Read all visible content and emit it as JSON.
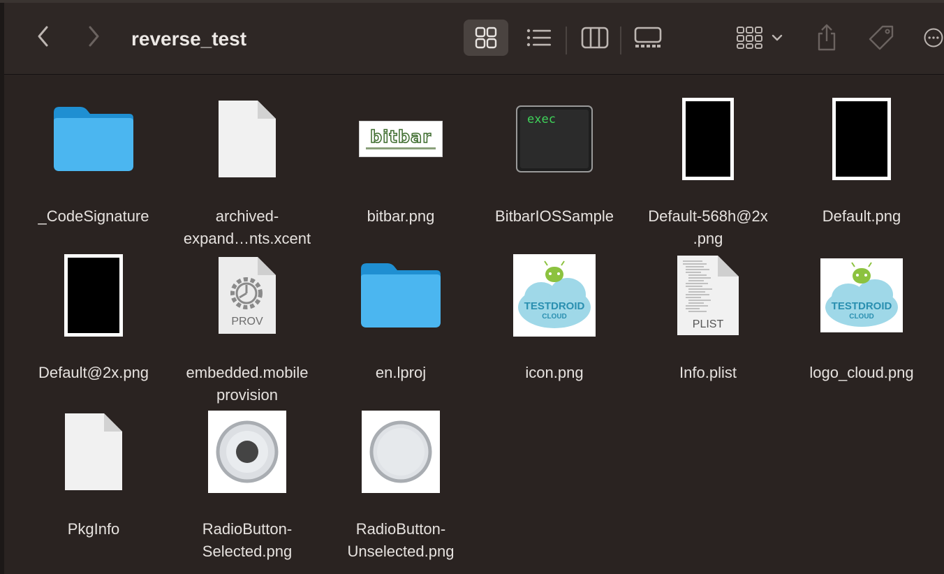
{
  "window": {
    "title": "reverse_test"
  },
  "toolbar": {
    "back_icon": "chevron-left-icon",
    "forward_icon": "chevron-right-icon",
    "view_modes": [
      "icon-grid-icon",
      "list-view-icon",
      "column-view-icon",
      "gallery-view-icon"
    ],
    "active_view": "icon-grid-icon",
    "group_icon": "group-by-icon",
    "share_icon": "share-icon",
    "tag_icon": "tag-icon",
    "more_icon": "more-icon"
  },
  "files": [
    {
      "name": "_CodeSignature",
      "kind": "folder"
    },
    {
      "name": "archived-\nexpand…nts.xcent",
      "kind": "document"
    },
    {
      "name": "bitbar.png",
      "kind": "image-bitbar",
      "thumb_text": "bitbar"
    },
    {
      "name": "BitbarIOSSample",
      "kind": "exec",
      "thumb_text": "exec"
    },
    {
      "name": "Default-568h@2x\n.png",
      "kind": "image-black-tall"
    },
    {
      "name": "Default.png",
      "kind": "image-black"
    },
    {
      "name": "Default@2x.png",
      "kind": "image-black"
    },
    {
      "name": "embedded.mobile\nprovision",
      "kind": "prov",
      "thumb_text": "PROV"
    },
    {
      "name": "en.lproj",
      "kind": "folder"
    },
    {
      "name": "icon.png",
      "kind": "image-testdroid",
      "thumb_text": "TESTDROID",
      "thumb_subtext": "CLOUD"
    },
    {
      "name": "Info.plist",
      "kind": "plist",
      "thumb_text": "PLIST"
    },
    {
      "name": "logo_cloud.png",
      "kind": "image-testdroid",
      "thumb_text": "TESTDROID",
      "thumb_subtext": "CLOUD"
    },
    {
      "name": "PkgInfo",
      "kind": "document"
    },
    {
      "name": "RadioButton-\nSelected.png",
      "kind": "radio-selected"
    },
    {
      "name": "RadioButton-\nUnselected.png",
      "kind": "radio-unselected"
    }
  ],
  "colors": {
    "background": "#2a2321",
    "folder": "#4bb6f0",
    "exec_text": "#3fd35a"
  }
}
